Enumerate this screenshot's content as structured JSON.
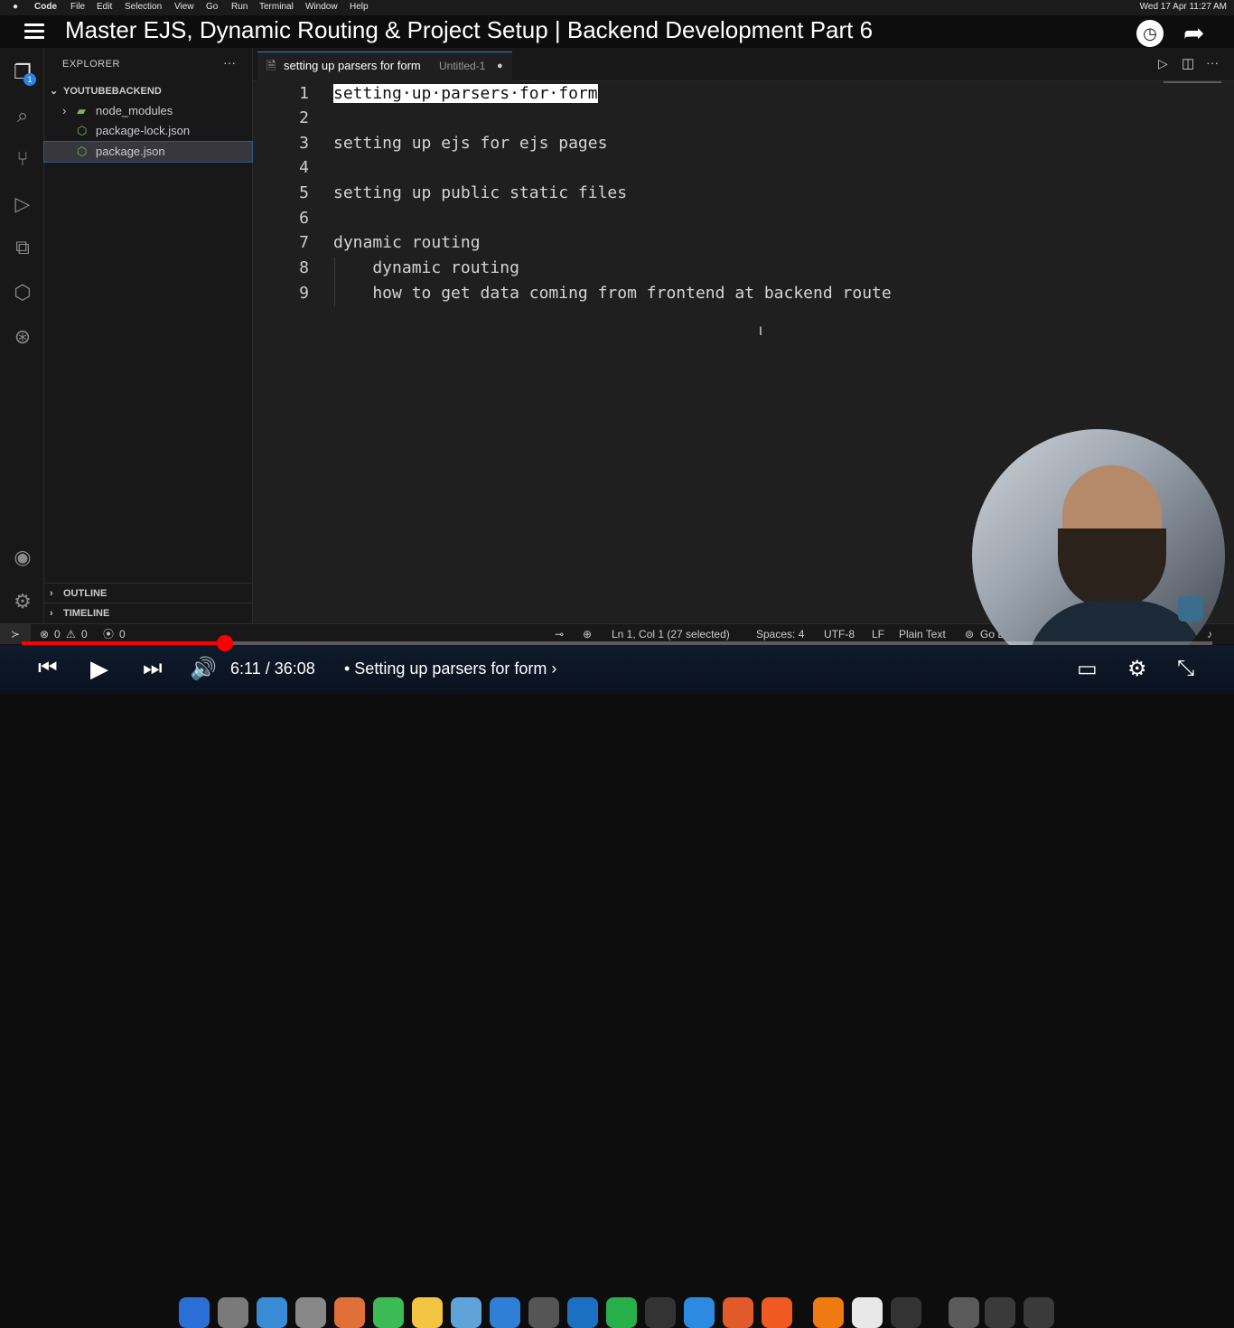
{
  "macmenu": {
    "app": "Code",
    "items": [
      "File",
      "Edit",
      "Selection",
      "View",
      "Go",
      "Run",
      "Terminal",
      "Window",
      "Help"
    ],
    "datetime": "Wed 17 Apr  11:27 AM"
  },
  "video": {
    "title": "Master EJS, Dynamic Routing & Project Setup | Backend Development Part 6",
    "current_time": "6:11",
    "duration": "36:08",
    "chapter": "• Setting up parsers for form",
    "progress": 0.171
  },
  "activity": {
    "explorer_badge": "1"
  },
  "explorer": {
    "title": "EXPLORER",
    "more": "···",
    "project": "YOUTUBEBACKEND",
    "items": [
      {
        "label": "node_modules"
      },
      {
        "label": "package-lock.json"
      },
      {
        "label": "package.json"
      }
    ],
    "sections": [
      "OUTLINE",
      "TIMELINE"
    ]
  },
  "tab": {
    "name": "setting up parsers for form",
    "description": "Untitled-1",
    "dirty_marker": "●"
  },
  "editor": {
    "lines": [
      {
        "num": "1",
        "text": "setting·up·parsers·for·form"
      },
      {
        "num": "2",
        "text": ""
      },
      {
        "num": "3",
        "text": "setting up ejs for ejs pages"
      },
      {
        "num": "4",
        "text": ""
      },
      {
        "num": "5",
        "text": "setting up public static files"
      },
      {
        "num": "6",
        "text": ""
      },
      {
        "num": "7",
        "text": "dynamic routing"
      },
      {
        "num": "8",
        "text": "    dynamic routing"
      },
      {
        "num": "9",
        "text": "    how to get data coming from frontend at backend route"
      }
    ]
  },
  "status": {
    "errors": "0",
    "warnings": "0",
    "ports": "0",
    "position": "Ln 1, Col 1 (27 selected)",
    "spaces": "Spaces: 4",
    "encoding": "UTF-8",
    "eol": "LF",
    "language": "Plain Text",
    "golive": "Go L"
  },
  "colors": {
    "accent": "#2f80ed",
    "progress": "#ff0000",
    "selection": "#ffffff"
  }
}
